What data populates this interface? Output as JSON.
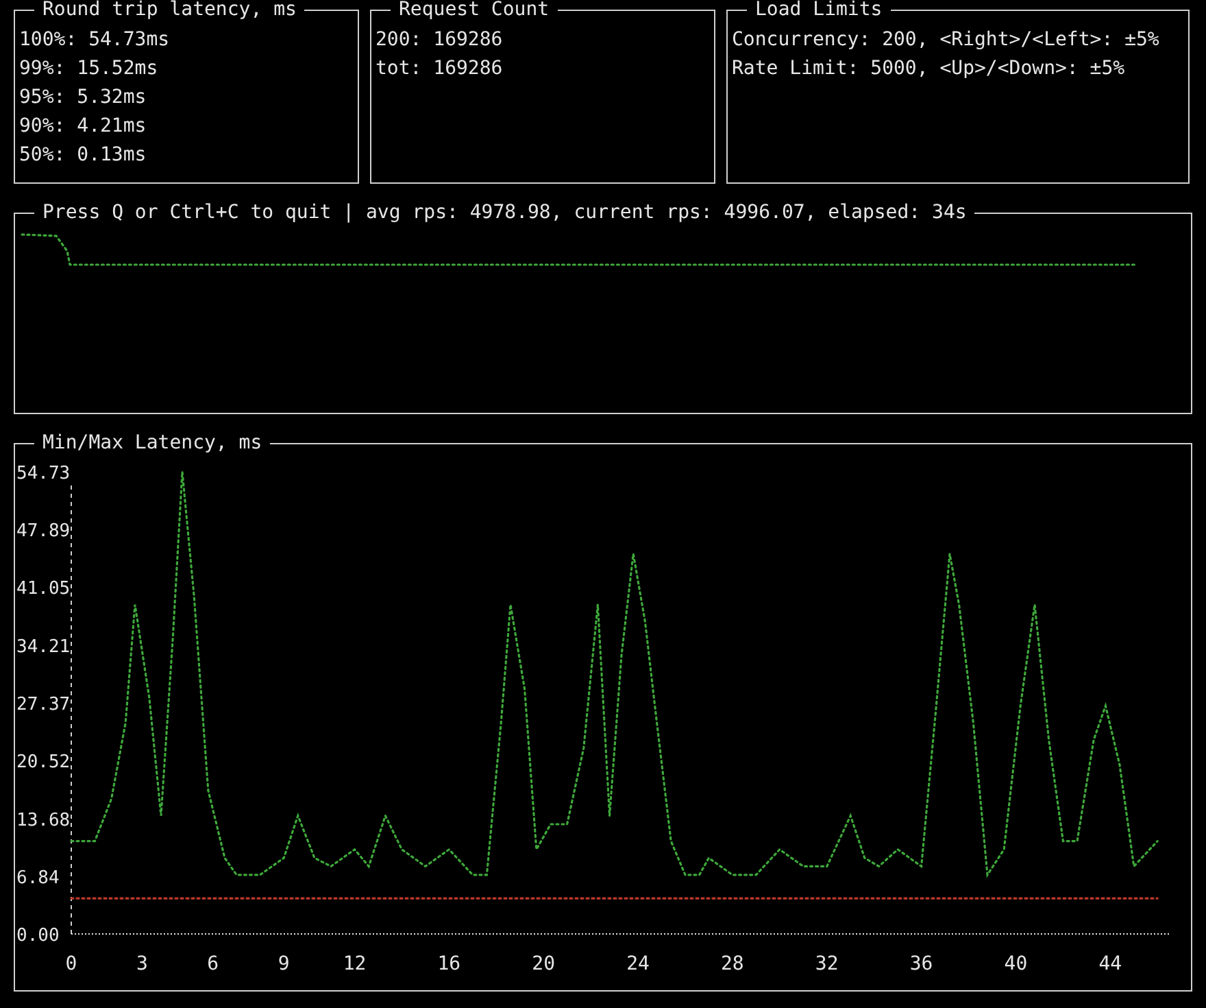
{
  "panels": [
    {
      "title": "Round trip latency, ms",
      "lines": [
        "100%: 54.73ms",
        "99%: 15.52ms",
        "95%: 5.32ms",
        "90%: 4.21ms",
        "50%: 0.13ms"
      ]
    },
    {
      "title": "Request Count",
      "lines": [
        "200: 169286",
        "tot: 169286"
      ]
    },
    {
      "title": "Load Limits",
      "lines": [
        "Concurrency: 200, <Right>/<Left>: ±5%",
        "Rate Limit: 5000, <Up>/<Down>: ±5%"
      ]
    }
  ],
  "throughput": {
    "title": "Press Q or Ctrl+C to quit | avg rps: 4978.98, current rps: 4996.07, elapsed: 34s"
  },
  "latency": {
    "title": "Min/Max Latency, ms",
    "chart_data": {
      "type": "line",
      "x": [
        0,
        1,
        1.7,
        2.3,
        2.7,
        3.3,
        3.8,
        4.3,
        4.7,
        5.2,
        5.8,
        6.5,
        7,
        8,
        9,
        9.6,
        10.3,
        11,
        12,
        12.6,
        13.3,
        14,
        15,
        16,
        17,
        17.6,
        18.2,
        18.6,
        19.2,
        19.7,
        20.3,
        21,
        21.7,
        22.3,
        22.8,
        23.3,
        23.8,
        24.3,
        24.8,
        25.4,
        26,
        26.6,
        27,
        28,
        29,
        30,
        31,
        32,
        33,
        33.6,
        34.2,
        35,
        36,
        36.6,
        37.2,
        37.6,
        38.2,
        38.8,
        39.5,
        40.2,
        40.8,
        41.4,
        42,
        42.6,
        43.3,
        43.8,
        44.4,
        45,
        46
      ],
      "series": [
        {
          "color": "#3ea83a",
          "line_style": "dotted",
          "values": [
            11,
            11,
            16,
            25,
            39,
            28,
            14,
            35,
            54.73,
            40,
            17,
            9,
            7,
            7,
            9,
            14,
            9,
            8,
            10,
            8,
            14,
            10,
            8,
            10,
            7,
            7,
            25,
            39,
            29,
            10,
            13,
            13,
            22,
            39,
            14,
            33,
            45,
            37,
            25,
            11,
            7,
            7,
            9,
            7,
            7,
            10,
            8,
            8,
            14,
            9,
            8,
            10,
            8,
            26,
            45,
            39,
            25,
            7,
            10,
            27,
            39,
            23,
            11,
            11,
            23,
            27,
            20,
            8,
            11
          ]
        },
        {
          "color": "#c0392b",
          "line_style": "dotted",
          "values": [
            4.2,
            4.2,
            4.2,
            4.2,
            4.2,
            4.2,
            4.2,
            4.2,
            4.2,
            4.2,
            4.2,
            4.2,
            4.2,
            4.2,
            4.2,
            4.2,
            4.2,
            4.2,
            4.2,
            4.2,
            4.2,
            4.2,
            4.2,
            4.2,
            4.2,
            4.2,
            4.2,
            4.2,
            4.2,
            4.2,
            4.2,
            4.2,
            4.2,
            4.2,
            4.2,
            4.2,
            4.2,
            4.2,
            4.2,
            4.2,
            4.2,
            4.2,
            4.2,
            4.2,
            4.2,
            4.2,
            4.2,
            4.2,
            4.2,
            4.2,
            4.2,
            4.2,
            4.2,
            4.2,
            4.2,
            4.2,
            4.2,
            4.2,
            4.2,
            4.2,
            4.2,
            4.2,
            4.2,
            4.2,
            4.2,
            4.2,
            4.2,
            4.2,
            4.2
          ]
        }
      ],
      "xlim": [
        0,
        46.5
      ],
      "ylim": [
        0,
        54.73
      ],
      "xticks": [
        0,
        3,
        6,
        9,
        12,
        16,
        20,
        24,
        28,
        32,
        36,
        40,
        44
      ],
      "yticks": [
        {
          "value": 0,
          "label": "0.00"
        },
        {
          "value": 6.84,
          "label": "6.84"
        },
        {
          "value": 13.68,
          "label": "13.68"
        },
        {
          "value": 20.52,
          "label": "20.52"
        },
        {
          "value": 27.37,
          "label": "27.37"
        },
        {
          "value": 34.21,
          "label": "34.21"
        },
        {
          "value": 41.05,
          "label": "41.05"
        },
        {
          "value": 47.89,
          "label": "47.89"
        },
        {
          "value": 54.73,
          "label": "54.73"
        }
      ]
    }
  }
}
